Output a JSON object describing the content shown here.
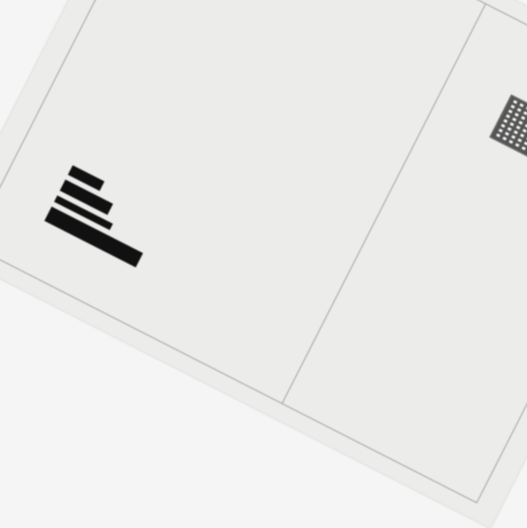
{
  "colors": {
    "page": "#ececea",
    "border": "#9a9a9a",
    "ink": "#111111",
    "stamp_blue": "#3a4d8a",
    "dark_edge": "#0f0f12"
  }
}
